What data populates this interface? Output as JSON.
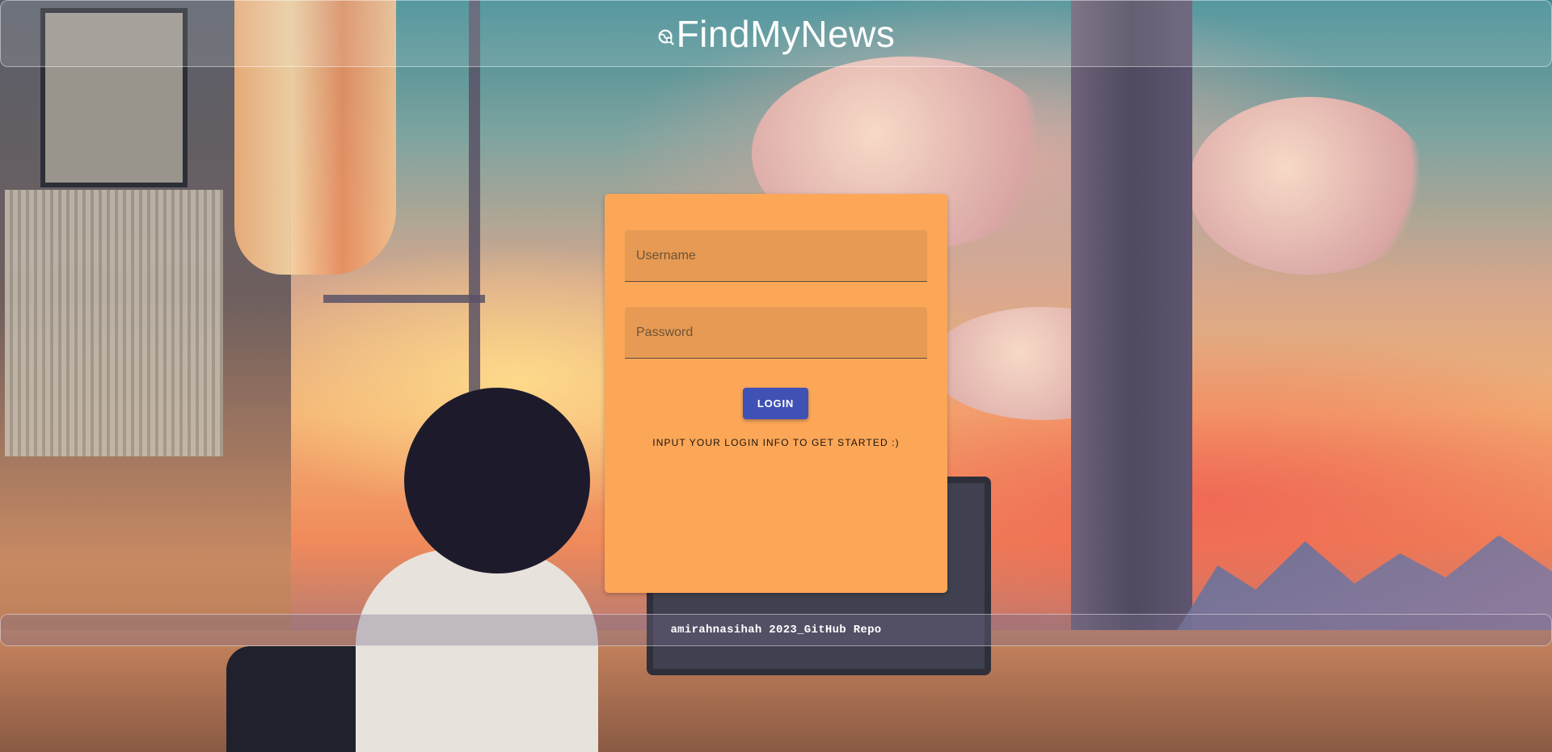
{
  "header": {
    "title": "FindMyNews",
    "icon": "globe-search-icon"
  },
  "login_form": {
    "username_placeholder": "Username",
    "password_placeholder": "Password",
    "login_label": "LOGIN",
    "hint": "INPUT YOUR LOGIN INFO TO GET STARTED :)"
  },
  "footer": {
    "text": "amirahnasihah 2023_GitHub Repo"
  },
  "colors": {
    "card": "#fca758",
    "field": "#e69a53",
    "button": "#3f51b5"
  }
}
